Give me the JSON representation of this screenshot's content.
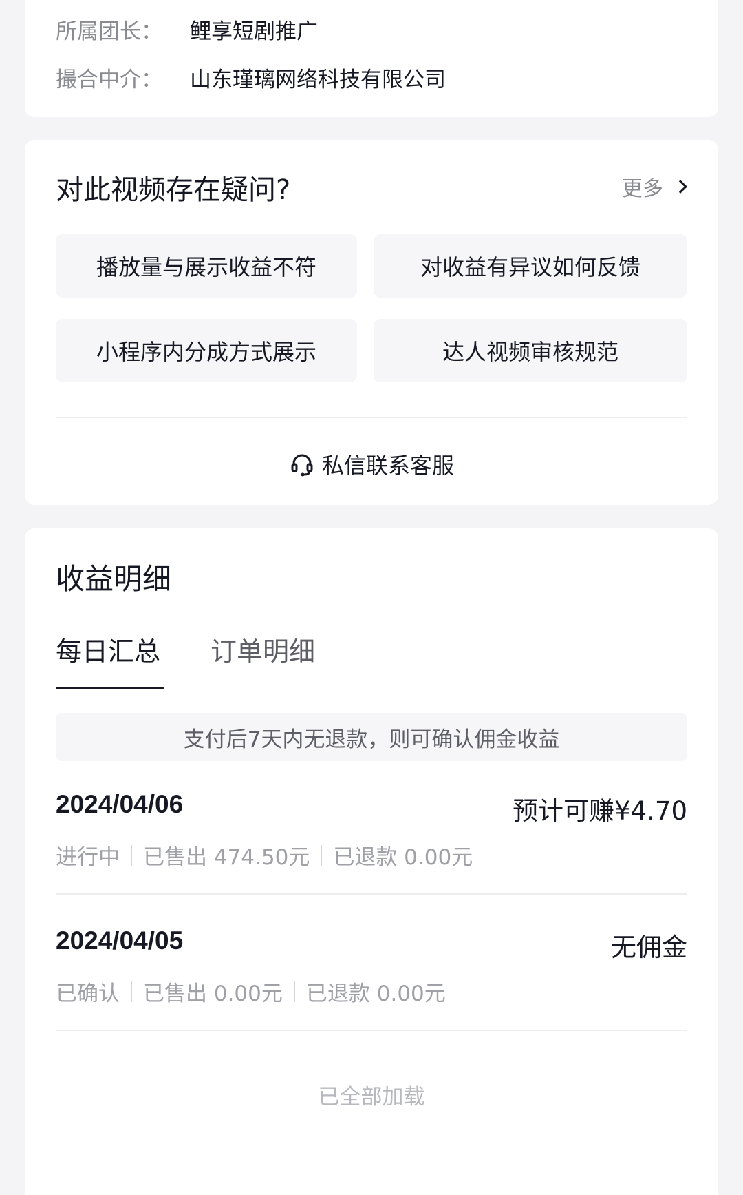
{
  "info": {
    "leader_label": "所属团长：",
    "leader_value": "鲤享短剧推广",
    "agency_label": "撮合中介：",
    "agency_value": "山东瑾璃网络科技有限公司"
  },
  "faq": {
    "title": "对此视频存在疑问?",
    "more_label": "更多",
    "items": [
      {
        "label": "播放量与展示收益不符"
      },
      {
        "label": "对收益有异议如何反馈"
      },
      {
        "label": "小程序内分成方式展示"
      },
      {
        "label": "达人视频审核规范"
      }
    ],
    "contact_label": "私信联系客服",
    "contact_icon": "headset-icon"
  },
  "income": {
    "title": "收益明细",
    "tabs": [
      {
        "label": "每日汇总",
        "active": true
      },
      {
        "label": "订单明细",
        "active": false
      }
    ],
    "notice": "支付后7天内无退款，则可确认佣金收益",
    "entries": [
      {
        "date": "2024/04/06",
        "amount": "预计可赚¥4.70",
        "status": "进行中",
        "sold": "已售出 474.50元",
        "refund": "已退款 0.00元"
      },
      {
        "date": "2024/04/05",
        "amount": "无佣金",
        "status": "已确认",
        "sold": "已售出 0.00元",
        "refund": "已退款 0.00元"
      }
    ],
    "loaded_text": "已全部加载"
  }
}
